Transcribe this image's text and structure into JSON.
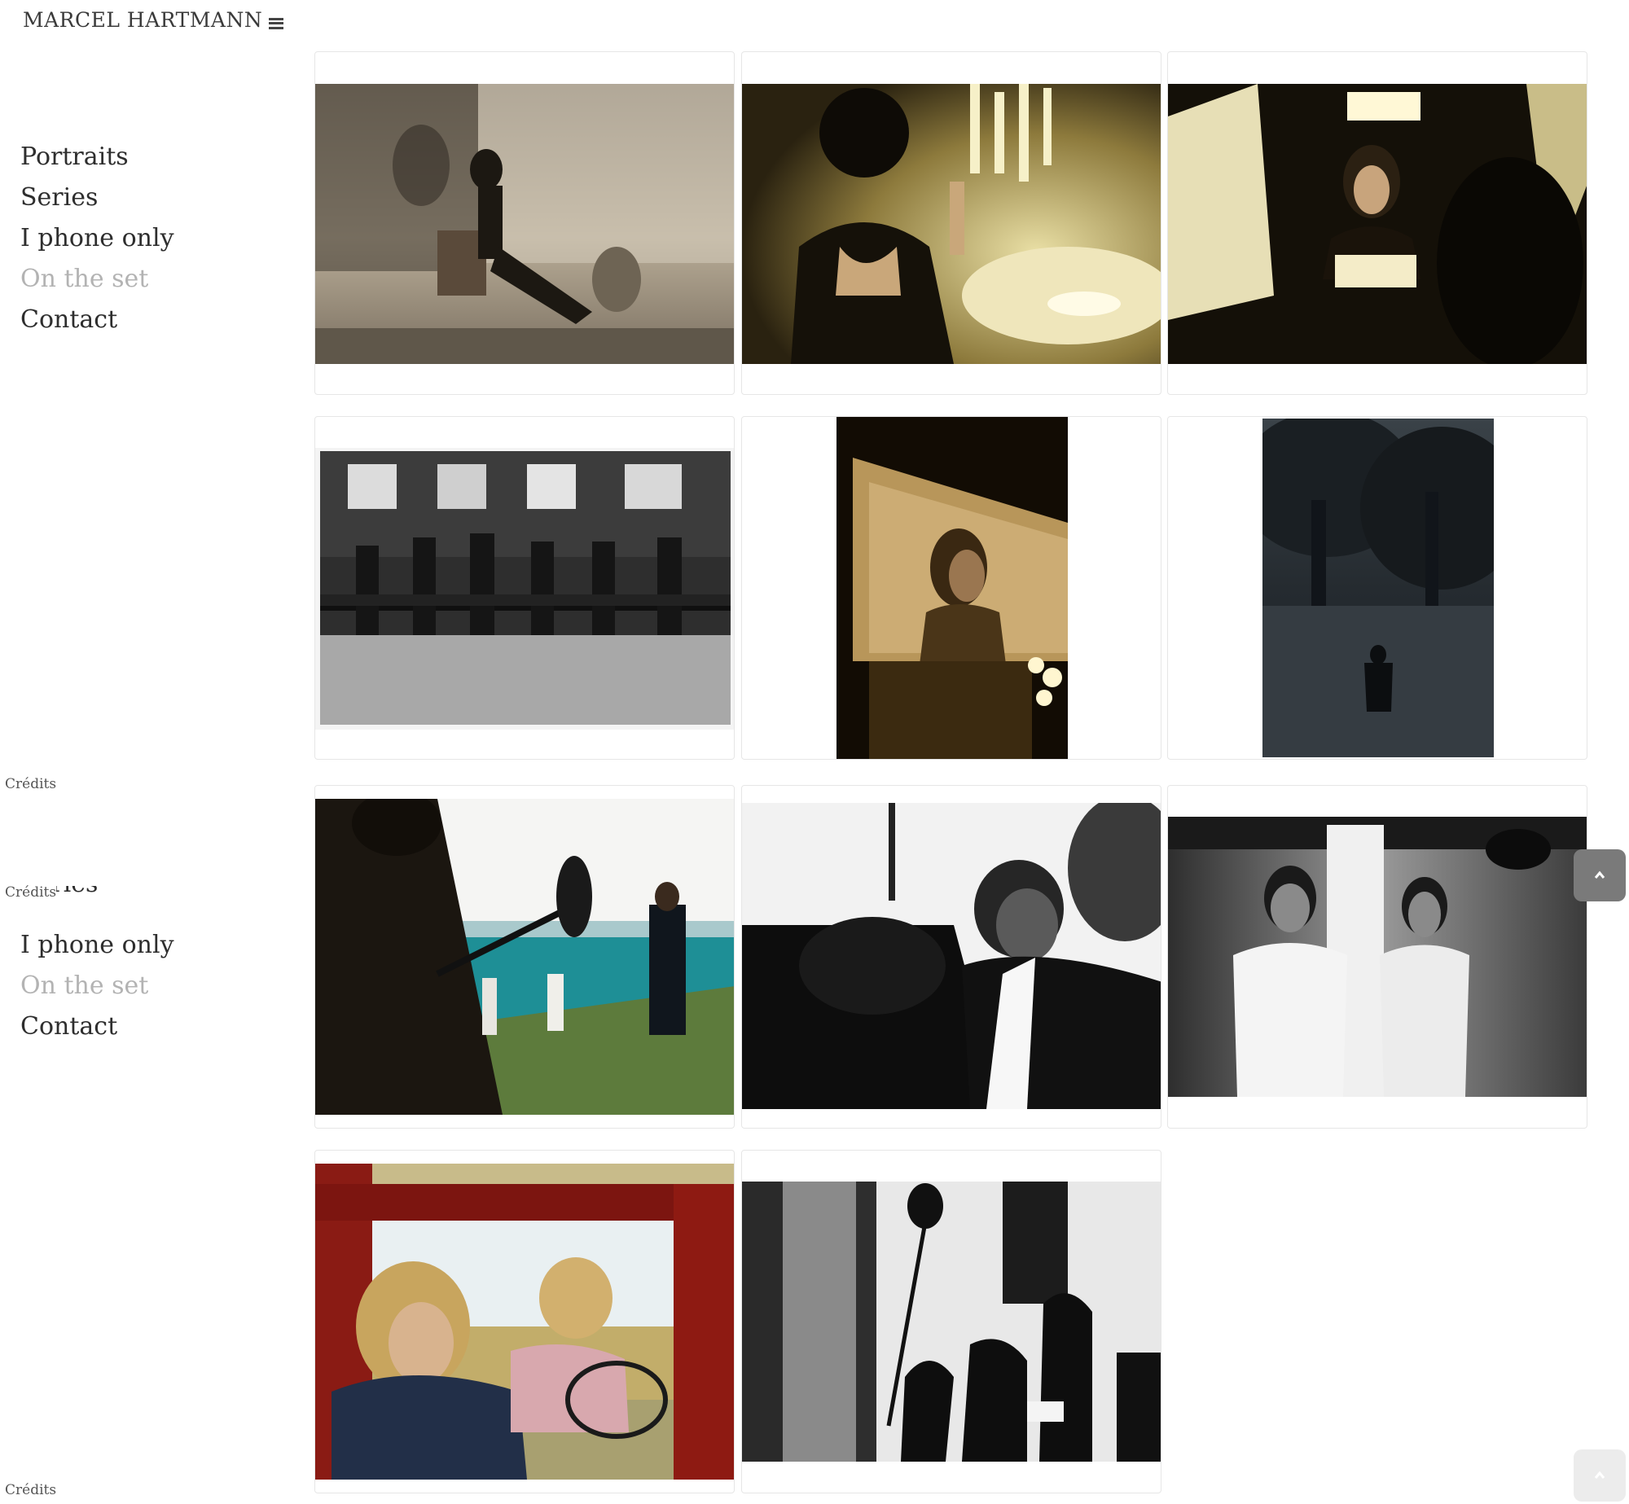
{
  "header": {
    "site_title": "MARCEL HARTMANN"
  },
  "nav": {
    "items": [
      {
        "label": "Portraits",
        "active": false
      },
      {
        "label": "Series",
        "active": false
      },
      {
        "label": "I phone only",
        "active": false
      },
      {
        "label": "On the set",
        "active": true
      },
      {
        "label": "Contact",
        "active": false
      }
    ],
    "credits_label": "Crédits"
  },
  "gallery": {
    "photos": [
      {
        "name": "woman-chair-fan",
        "tone": "sepia"
      },
      {
        "name": "woman-cigarette-dinner",
        "tone": "sepia"
      },
      {
        "name": "woman-mirror-lamp",
        "tone": "sepia"
      },
      {
        "name": "men-carrying-rail-train",
        "tone": "bw"
      },
      {
        "name": "bearded-man-window",
        "tone": "sepia"
      },
      {
        "name": "man-walking-dark-park",
        "tone": "bw-blue"
      },
      {
        "name": "boom-operator-seaside",
        "tone": "color"
      },
      {
        "name": "director-camera-scarf",
        "tone": "bw"
      },
      {
        "name": "man-mirror-shirt",
        "tone": "bw"
      },
      {
        "name": "women-red-truck",
        "tone": "color"
      },
      {
        "name": "shadows-on-wall",
        "tone": "bw"
      }
    ]
  },
  "icons": {
    "menu": "hamburger-icon",
    "back_to_top": "chevron-up-icon"
  }
}
